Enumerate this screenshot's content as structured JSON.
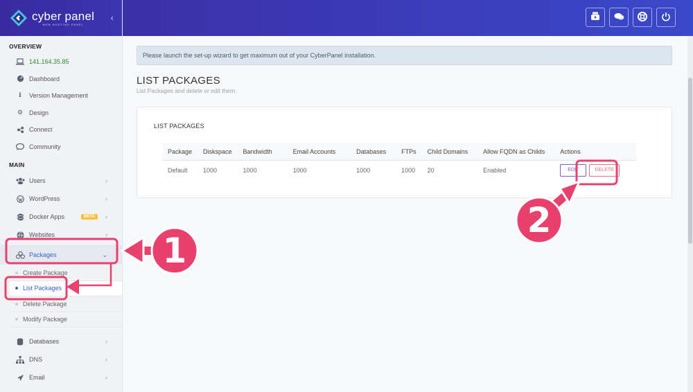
{
  "brand": {
    "name": "cyber panel",
    "tagline": "WEB HOSTING PANEL",
    "collapse_icon": "chevron-left-icon"
  },
  "header": {
    "buttons": [
      "youtube-icon",
      "chat-icon",
      "lifebuoy-icon",
      "power-icon"
    ]
  },
  "sidebar": {
    "overview_title": "OVERVIEW",
    "ip": "141.164.35.85",
    "overview_items": [
      {
        "label": "Dashboard",
        "icon": "dashboard-icon"
      },
      {
        "label": "Version Management",
        "icon": "info-icon"
      },
      {
        "label": "Design",
        "icon": "gear-icon"
      },
      {
        "label": "Connect",
        "icon": "link-icon"
      },
      {
        "label": "Community",
        "icon": "chat-icon"
      }
    ],
    "main_title": "MAIN",
    "main_items": [
      {
        "label": "Users",
        "icon": "users-icon"
      },
      {
        "label": "WordPress",
        "icon": "wordpress-icon"
      },
      {
        "label": "Docker Apps",
        "icon": "docker-icon",
        "badge": "BETA"
      },
      {
        "label": "Websites",
        "icon": "globe-icon"
      },
      {
        "label": "Packages",
        "icon": "packages-icon"
      }
    ],
    "package_sub": [
      "Create Package",
      "List Packages",
      "Delete Package",
      "Modify Package"
    ],
    "lower_items": [
      {
        "label": "Databases",
        "icon": "database-icon"
      },
      {
        "label": "DNS",
        "icon": "sitemap-icon"
      },
      {
        "label": "Email",
        "icon": "paper-plane-icon"
      }
    ]
  },
  "notice": "Please launch the set-up wizard to get maximum out of your CyberPanel installation.",
  "page": {
    "title": "LIST PACKAGES",
    "subtitle": "List Packages and delete or edit them."
  },
  "card": {
    "title": "LIST PACKAGES",
    "columns": [
      "Package",
      "Diskspace",
      "Bandwidth",
      "Email Accounts",
      "Databases",
      "FTPs",
      "Child Domains",
      "Allow FQDN as Childs",
      "Actions"
    ],
    "rows": [
      {
        "package": "Default",
        "diskspace": "1000",
        "bandwidth": "1000",
        "email": "1000",
        "databases": "1000",
        "ftps": "1000",
        "child": "20",
        "fqdn": "Enabled",
        "edit": "EDIT",
        "delete": "DELETE"
      }
    ]
  },
  "annotations": {
    "step1": "1",
    "step2": "2",
    "color": "#e8416d"
  }
}
